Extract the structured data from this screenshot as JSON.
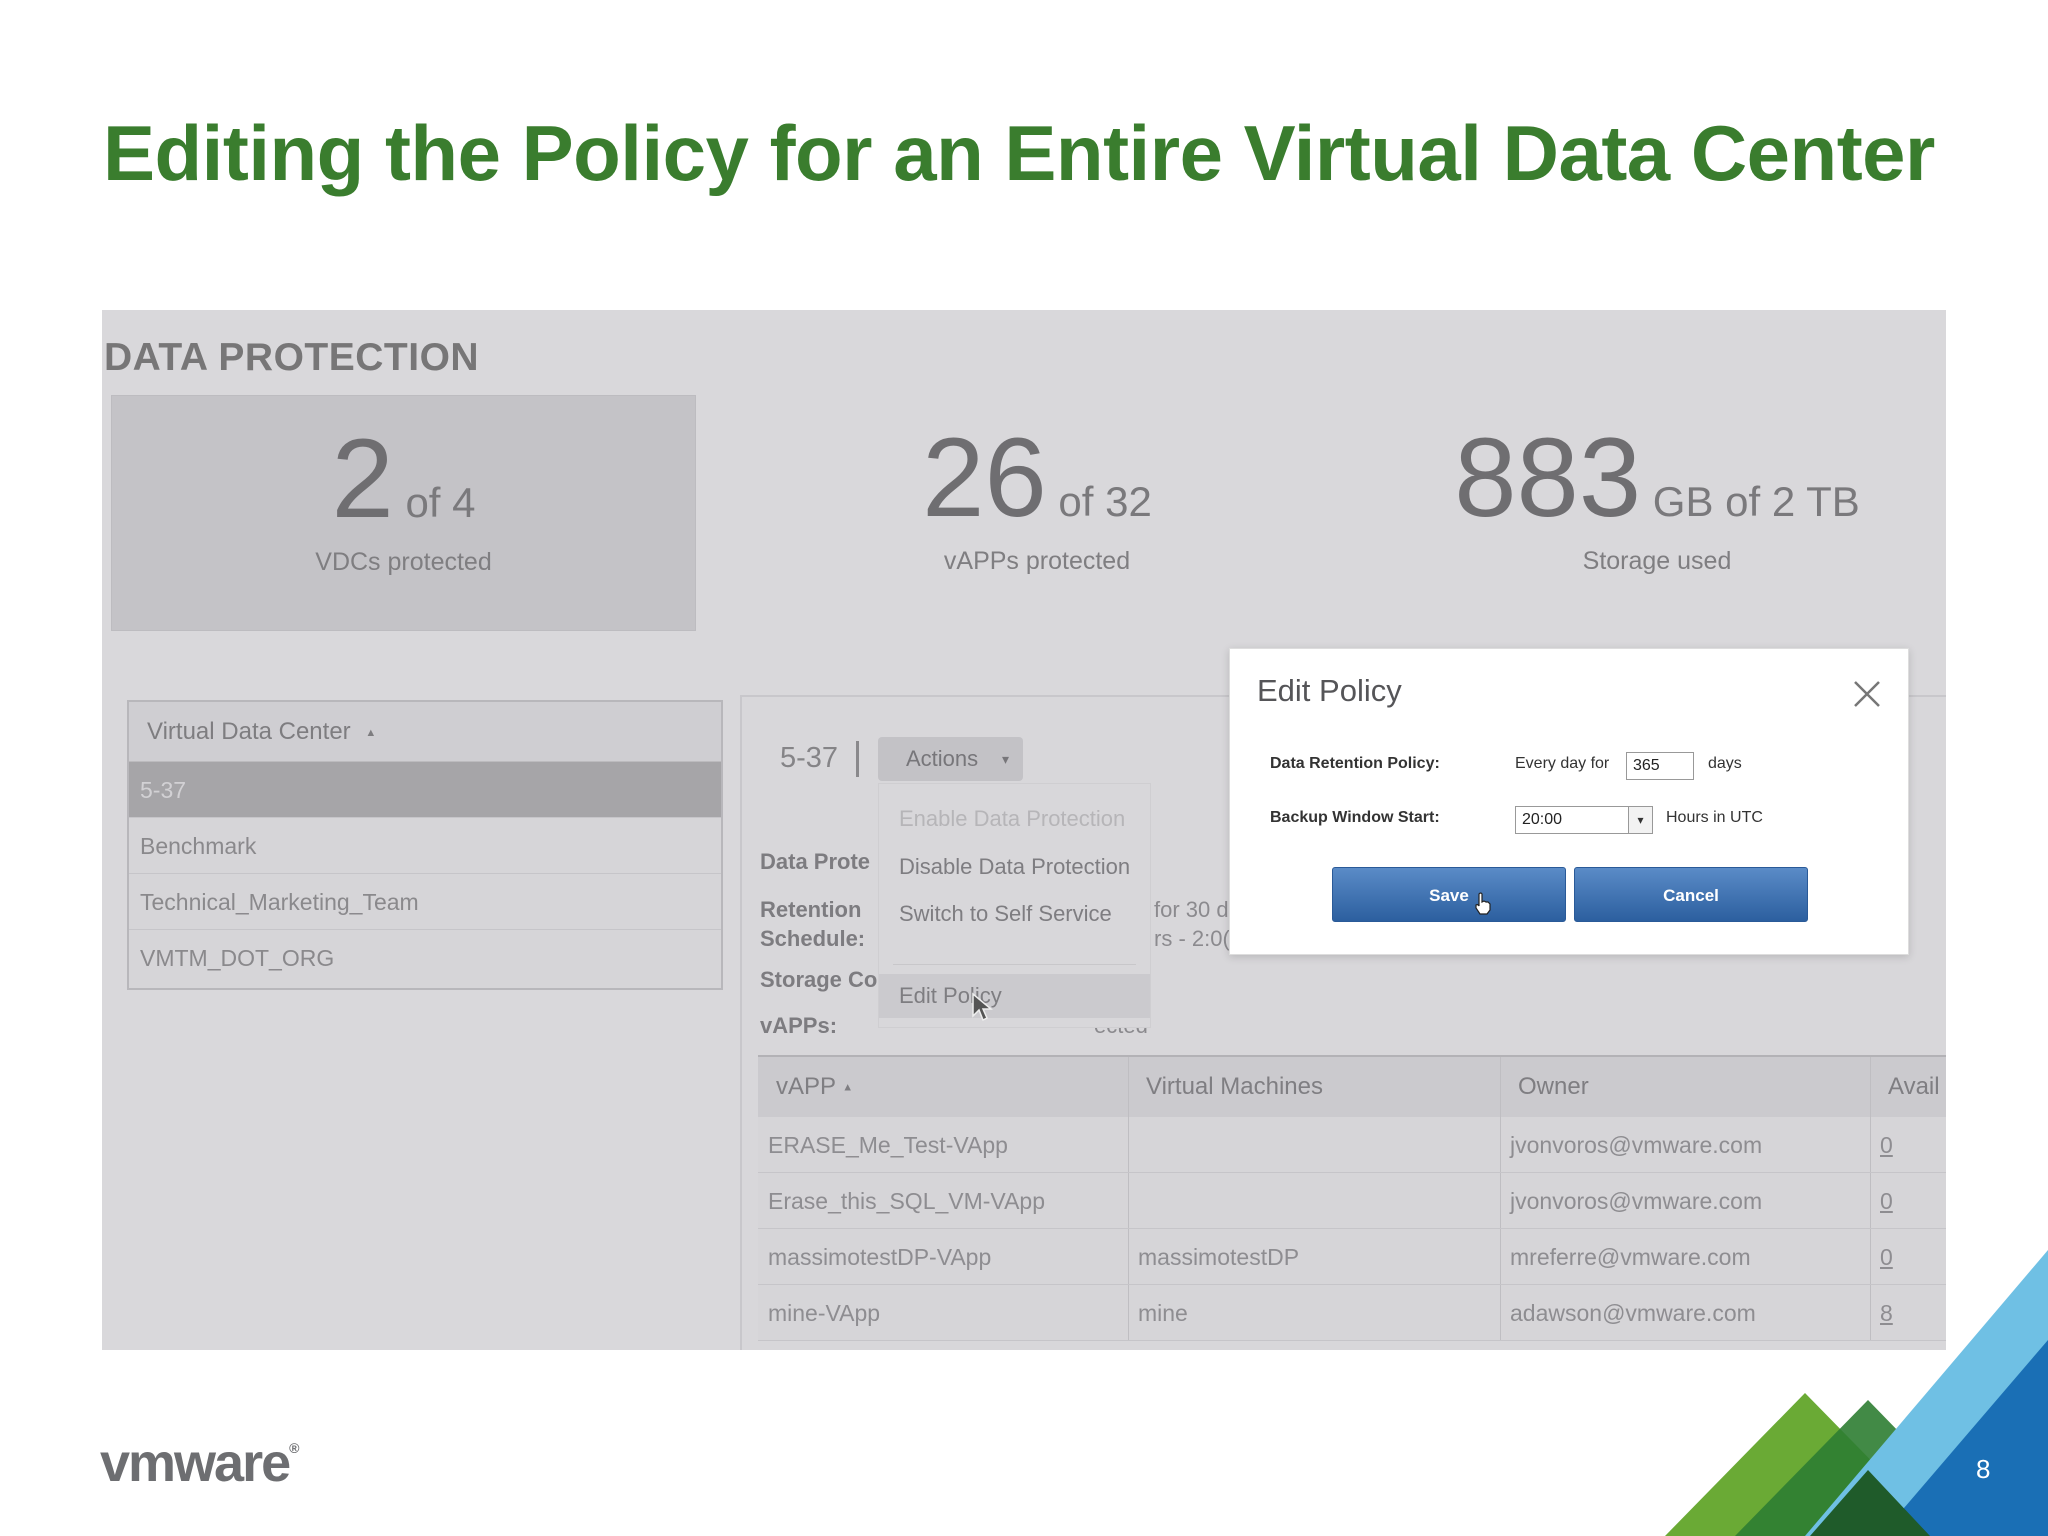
{
  "slide": {
    "title": "Editing the Policy for an Entire Virtual Data Center",
    "page_number": "8",
    "logo_text": "vmware",
    "logo_mark": "®"
  },
  "screen": {
    "title": "DATA PROTECTION",
    "stats": [
      {
        "big": "2",
        "of": " of 4",
        "caption": "VDCs protected"
      },
      {
        "big": "26",
        "of": " of 32",
        "caption": "vAPPs protected"
      },
      {
        "big": "883",
        "of": " GB of 2 TB",
        "caption": "Storage used"
      }
    ],
    "vdc_table": {
      "header": "Virtual Data Center",
      "sort_icon": "▲",
      "rows": [
        "5-37",
        "Benchmark",
        "Technical_Marketing_Team",
        "VMTM_DOT_ORG"
      ]
    },
    "detail": {
      "vdc_name": "5-37",
      "actions_label": "Actions",
      "actions_caret": "▾",
      "labels": {
        "data_protection": "Data Prote",
        "retention": "Retention",
        "schedule": "Schedule:",
        "storage": "Storage Co",
        "vapps": "vAPPs:"
      },
      "values": {
        "retention_partial": "for 30 d",
        "schedule_partial": "rs - 2:0(",
        "vapps_partial": "ected"
      }
    },
    "actions_menu": [
      {
        "label": "Enable Data Protection",
        "disabled": true
      },
      {
        "label": "Disable Data Protection",
        "disabled": false
      },
      {
        "label": "Switch to Self Service",
        "disabled": false
      },
      {
        "label": "Edit Policy",
        "disabled": false
      }
    ],
    "vapp_table": {
      "columns": [
        "vAPP",
        "Virtual Machines",
        "Owner",
        "Avail"
      ],
      "sort_icon": "▲",
      "rows": [
        {
          "vapp": "ERASE_Me_Test-VApp",
          "vms": "",
          "owner": "jvonvoros@vmware.com",
          "avail": "0"
        },
        {
          "vapp": "Erase_this_SQL_VM-VApp",
          "vms": "",
          "owner": "jvonvoros@vmware.com",
          "avail": "0"
        },
        {
          "vapp": "massimotestDP-VApp",
          "vms": "massimotestDP",
          "owner": "mreferre@vmware.com",
          "avail": "0"
        },
        {
          "vapp": "mine-VApp",
          "vms": "mine",
          "owner": "adawson@vmware.com",
          "avail": "8"
        }
      ]
    }
  },
  "dialog": {
    "title": "Edit Policy",
    "retention_label": "Data Retention Policy:",
    "retention_prefix": "Every day for",
    "retention_value": "365",
    "retention_suffix": "days",
    "window_label": "Backup Window Start:",
    "window_value": "20:00",
    "window_arrow": "▾",
    "window_suffix": "Hours in UTC",
    "save_label": "Save",
    "cancel_label": "Cancel"
  },
  "colors": {
    "title_green": "#3a7d2e",
    "button_blue": "#2c5f9f",
    "corner_green_light": "#6aaa35",
    "corner_green_dark": "#2e7d32",
    "corner_blue_light": "#6fc0e4",
    "corner_blue_dark": "#1a6fb5"
  }
}
